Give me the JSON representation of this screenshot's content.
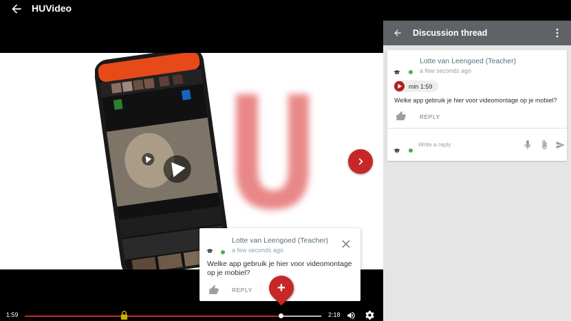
{
  "app": {
    "title": "HUVideo"
  },
  "video": {
    "brand_letter": "U"
  },
  "popup": {
    "author": "Lotte van Leengoed (Teacher)",
    "time": "a few seconds ago",
    "message": "Welke app gebruik je hier voor videomontage op je mobiel?",
    "reply_label": "REPLY"
  },
  "fab": {
    "label": "+"
  },
  "controls": {
    "current_time": "1:59",
    "duration": "2:18",
    "progress": 0.862
  },
  "panel": {
    "title": "Discussion thread",
    "comment": {
      "author": "Lotte van Leengoed (Teacher)",
      "time": "a few seconds ago",
      "timestamp": "min 1:59",
      "message": "Welke app gebruik je hier voor videomontage op je mobiel?",
      "reply_label": "REPLY"
    },
    "reply_input": {
      "placeholder": "Write a reply",
      "value": ""
    }
  },
  "colors": {
    "accent": "#c62828",
    "panel_header": "#5f6368",
    "online": "#4caf50"
  },
  "icons": [
    "arrow-back-icon",
    "chevron-right-icon",
    "close-icon",
    "graduation-cap-icon",
    "thumbs-up-icon",
    "play-icon",
    "lock-icon",
    "volume-icon",
    "gear-icon",
    "more-vert-icon",
    "mic-icon",
    "paperclip-icon",
    "send-icon"
  ]
}
